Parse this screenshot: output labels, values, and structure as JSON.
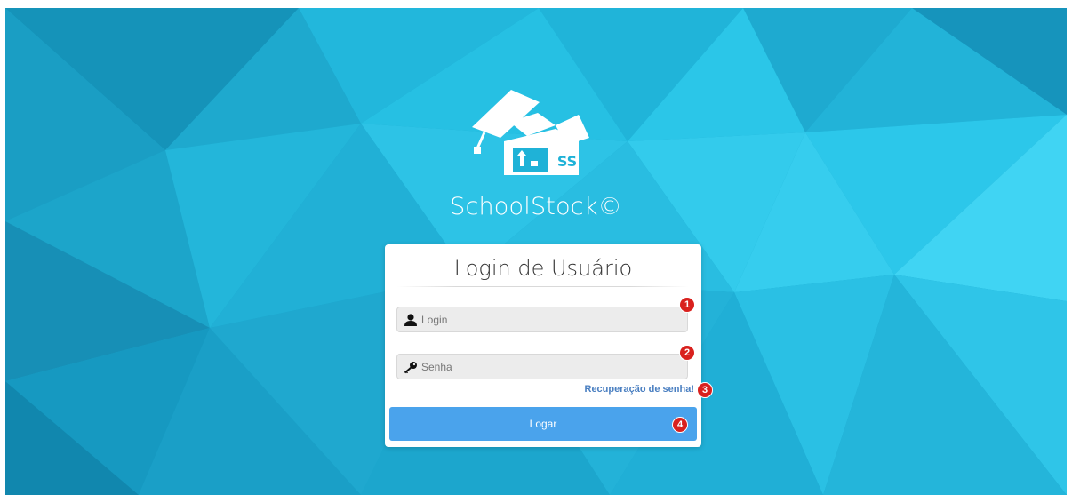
{
  "app": {
    "name": "SchoolStock©",
    "logo_icon": "schoolstock-logo-icon",
    "logo_badge": "SS"
  },
  "login": {
    "title": "Login de Usuário",
    "username": {
      "placeholder": "Login",
      "value": "",
      "icon": "user-icon"
    },
    "password": {
      "placeholder": "Senha",
      "value": "",
      "icon": "key-icon"
    },
    "recover_link": "Recuperação de senha!",
    "submit_label": "Logar"
  },
  "annotations": [
    "1",
    "2",
    "3",
    "4"
  ],
  "colors": {
    "background": "#1db4d8",
    "button": "#4aa3ec",
    "link": "#4a7fc1",
    "marker": "#d9211e"
  }
}
